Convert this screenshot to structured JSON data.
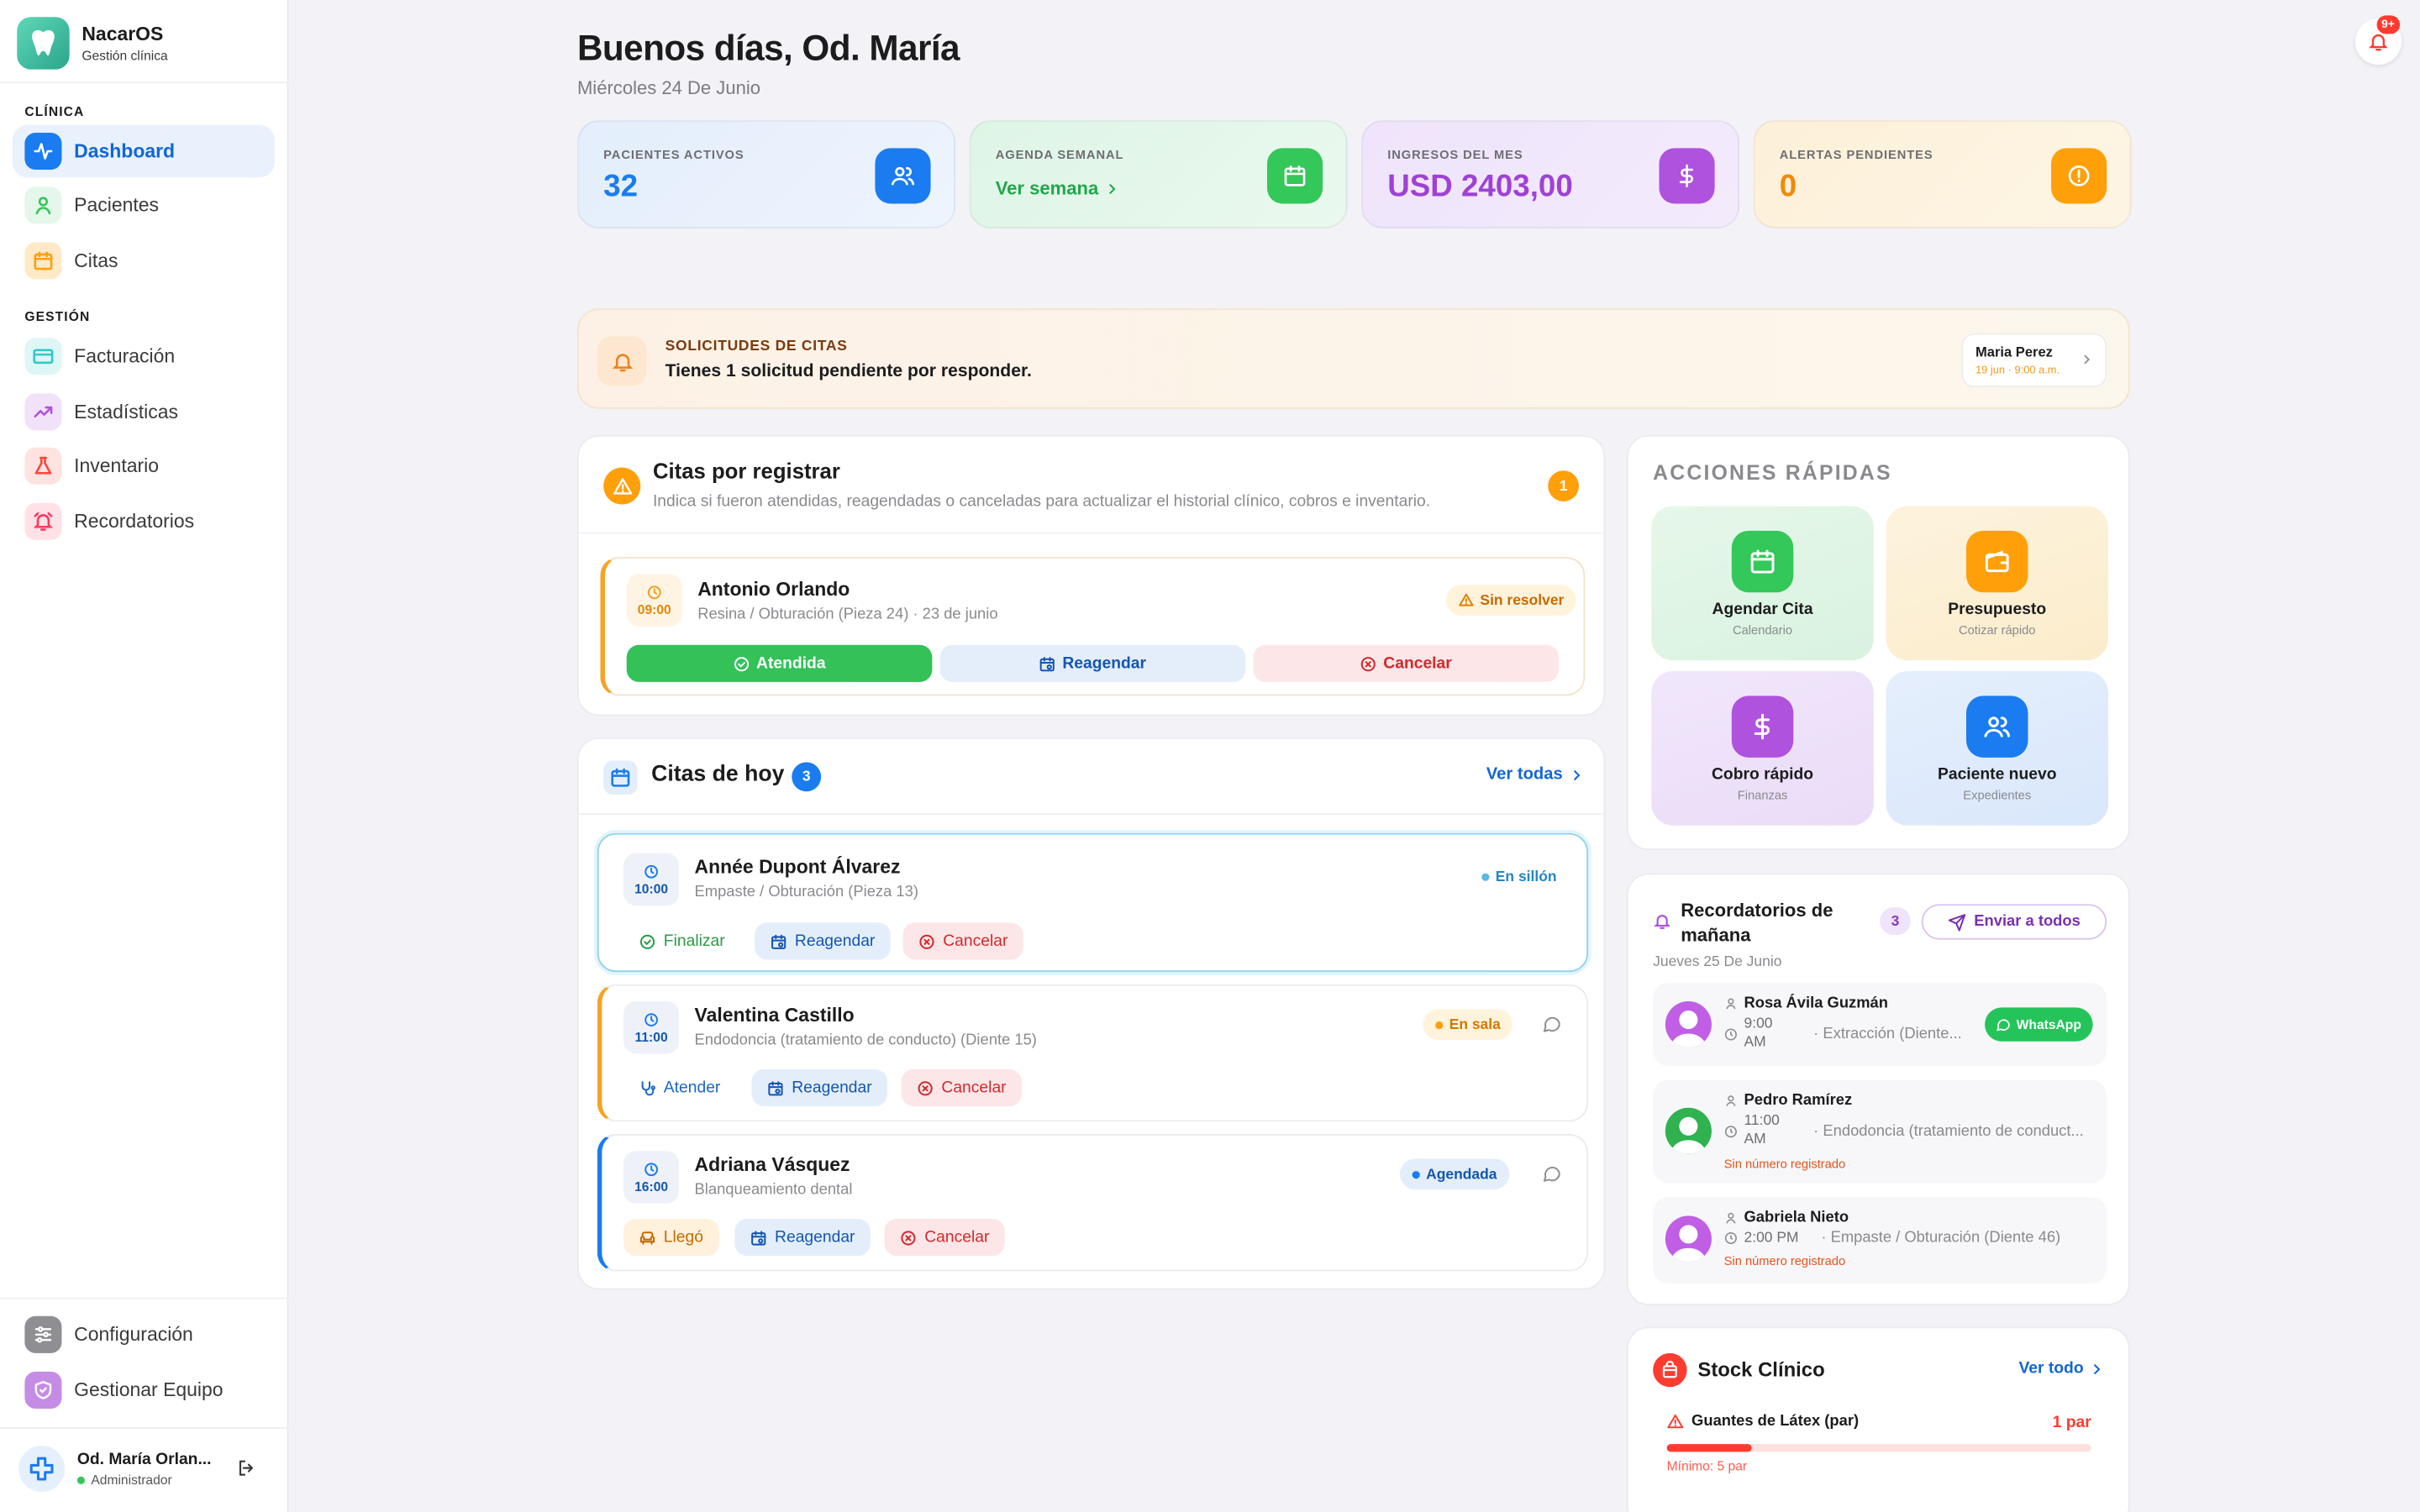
{
  "brand": {
    "name": "NacarOS",
    "subtitle": "Gestión clínica"
  },
  "sidebar": {
    "section_clinic": "CLÍNICA",
    "section_management": "GESTIÓN",
    "items": [
      {
        "label": "Dashboard",
        "icon": "activity-icon",
        "color": "#1a7cf0"
      },
      {
        "label": "Pacientes",
        "icon": "user-icon",
        "color": "#34c759"
      },
      {
        "label": "Citas",
        "icon": "calendar-icon",
        "color": "#ff9f0a"
      },
      {
        "label": "Facturación",
        "icon": "credit-card-icon",
        "color": "#30c8c8"
      },
      {
        "label": "Estadísticas",
        "icon": "trending-up-icon",
        "color": "#af52de"
      },
      {
        "label": "Inventario",
        "icon": "flask-icon",
        "color": "#ff453a"
      },
      {
        "label": "Recordatorios",
        "icon": "alarm-icon",
        "color": "#ff375f"
      }
    ],
    "bottom": [
      {
        "label": "Configuración",
        "icon": "sliders-icon",
        "color": "#8e8e93"
      },
      {
        "label": "Gestionar Equipo",
        "icon": "shield-icon",
        "color": "#af52de"
      }
    ],
    "user": {
      "name": "Od. María Orlan...",
      "role": "Administrador"
    }
  },
  "header": {
    "greeting": "Buenos días, Od. María",
    "date": "Miércoles 24 De Junio",
    "notif_badge": "9+"
  },
  "stats": [
    {
      "label": "PACIENTES ACTIVOS",
      "value": "32",
      "color": "#1a7cf0"
    },
    {
      "label": "AGENDA SEMANAL",
      "value": "Ver semana",
      "color": "#1fa84a"
    },
    {
      "label": "INGRESOS DEL MES",
      "value": "USD 2403,00",
      "color": "#a041d6"
    },
    {
      "label": "ALERTAS PENDIENTES",
      "value": "0",
      "color": "#f08a0a"
    }
  ],
  "requests": {
    "title": "SOLICITUDES DE CITAS",
    "text": "Tienes 1 solicitud pendiente por responder.",
    "chip_name": "Maria Perez",
    "chip_date": "19 jun · 9:00 a.m."
  },
  "pending": {
    "title": "Citas por registrar",
    "subtitle": "Indica si fueron atendidas, reagendadas o canceladas para actualizar el historial clínico, cobros e inventario.",
    "count": "1",
    "item": {
      "time": "09:00",
      "name": "Antonio Orlando",
      "desc": "Resina / Obturación (Pieza 24) · 23 de junio",
      "status": "Sin resolver"
    },
    "actions": {
      "done": "Atendida",
      "reschedule": "Reagendar",
      "cancel": "Cancelar"
    }
  },
  "today": {
    "title": "Citas de hoy",
    "count": "3",
    "view_all": "Ver todas",
    "appointments": [
      {
        "time": "10:00",
        "name": "Année Dupont Álvarez",
        "desc": "Empaste / Obturación (Pieza 13)",
        "status": "En sillón",
        "primary": "Finalizar",
        "reschedule": "Reagendar",
        "cancel": "Cancelar"
      },
      {
        "time": "11:00",
        "name": "Valentina Castillo",
        "desc": "Endodoncia (tratamiento de conducto) (Diente 15)",
        "status": "En sala",
        "primary": "Atender",
        "reschedule": "Reagendar",
        "cancel": "Cancelar"
      },
      {
        "time": "16:00",
        "name": "Adriana Vásquez",
        "desc": "Blanqueamiento dental",
        "status": "Agendada",
        "primary": "Llegó",
        "reschedule": "Reagendar",
        "cancel": "Cancelar"
      }
    ]
  },
  "quick_actions": {
    "title": "ACCIONES RÁPIDAS",
    "items": [
      {
        "label": "Agendar Cita",
        "sub": "Calendario",
        "icon": "calendar-icon",
        "color": "#34c759"
      },
      {
        "label": "Presupuesto",
        "sub": "Cotizar rápido",
        "icon": "wallet-icon",
        "color": "#ff9f0a"
      },
      {
        "label": "Cobro rápido",
        "sub": "Finanzas",
        "icon": "dollar-icon",
        "color": "#af52de"
      },
      {
        "label": "Paciente nuevo",
        "sub": "Expedientes",
        "icon": "users-icon",
        "color": "#1a7cf0"
      }
    ]
  },
  "reminders": {
    "title": "Recordatorios de mañana",
    "count": "3",
    "send_all": "Enviar a todos",
    "date": "Jueves 25 De Junio",
    "items": [
      {
        "name": "Rosa Ávila Guzmán",
        "time": "9:00 AM",
        "proc": "· Extracción (Diente...",
        "action": "WhatsApp"
      },
      {
        "name": "Pedro Ramírez",
        "time": "11:00 AM",
        "proc": "· Endodoncia (tratamiento de conduct...",
        "warning": "Sin número registrado"
      },
      {
        "name": "Gabriela Nieto",
        "time": "2:00 PM",
        "proc": "· Empaste / Obturación (Diente 46)",
        "warning": "Sin número registrado"
      }
    ]
  },
  "stock": {
    "title": "Stock Clínico",
    "view_all": "Ver todo",
    "item": {
      "name": "Guantes de Látex (par)",
      "qty": "1 par",
      "min": "Mínimo: 5 par",
      "level_fraction": 0.2
    }
  }
}
